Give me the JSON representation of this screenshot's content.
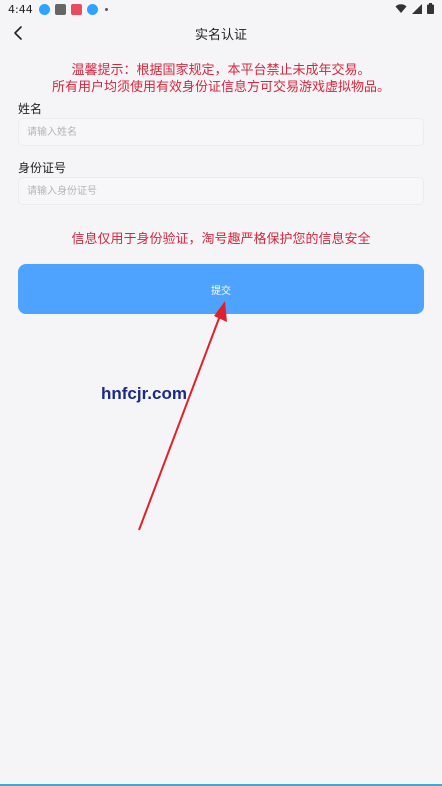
{
  "status_bar": {
    "time": "4:44",
    "app_icons": [
      {
        "icon": "qq-icon",
        "color": "#2fa3ff"
      },
      {
        "icon": "bilibili-icon",
        "color": "#555555"
      },
      {
        "icon": "app-red-icon",
        "color": "#e84a5f"
      },
      {
        "icon": "download-icon",
        "color": "#2fa3ff"
      }
    ],
    "right_icons": [
      "wifi-icon",
      "signal-icon",
      "battery-icon"
    ]
  },
  "header": {
    "title": "实名认证",
    "back_icon": "chevron-left-icon"
  },
  "notice": {
    "line1": "温馨提示：根据国家规定，本平台禁止未成年交易。",
    "line2": "所有用户均须使用有效身份证信息方可交易游戏虚拟物品。",
    "color": "#d7263d"
  },
  "form": {
    "name_label": "姓名",
    "name_placeholder": "请输入姓名",
    "name_value": "",
    "id_label": "身份证号",
    "id_placeholder": "请输入身份证号",
    "id_value": ""
  },
  "privacy_note": "信息仅用于身份验证，淘号趣严格保护您的信息安全",
  "submit_label": "提交",
  "accent_color": "#4da3ff",
  "watermark": "hnfcjr.com"
}
